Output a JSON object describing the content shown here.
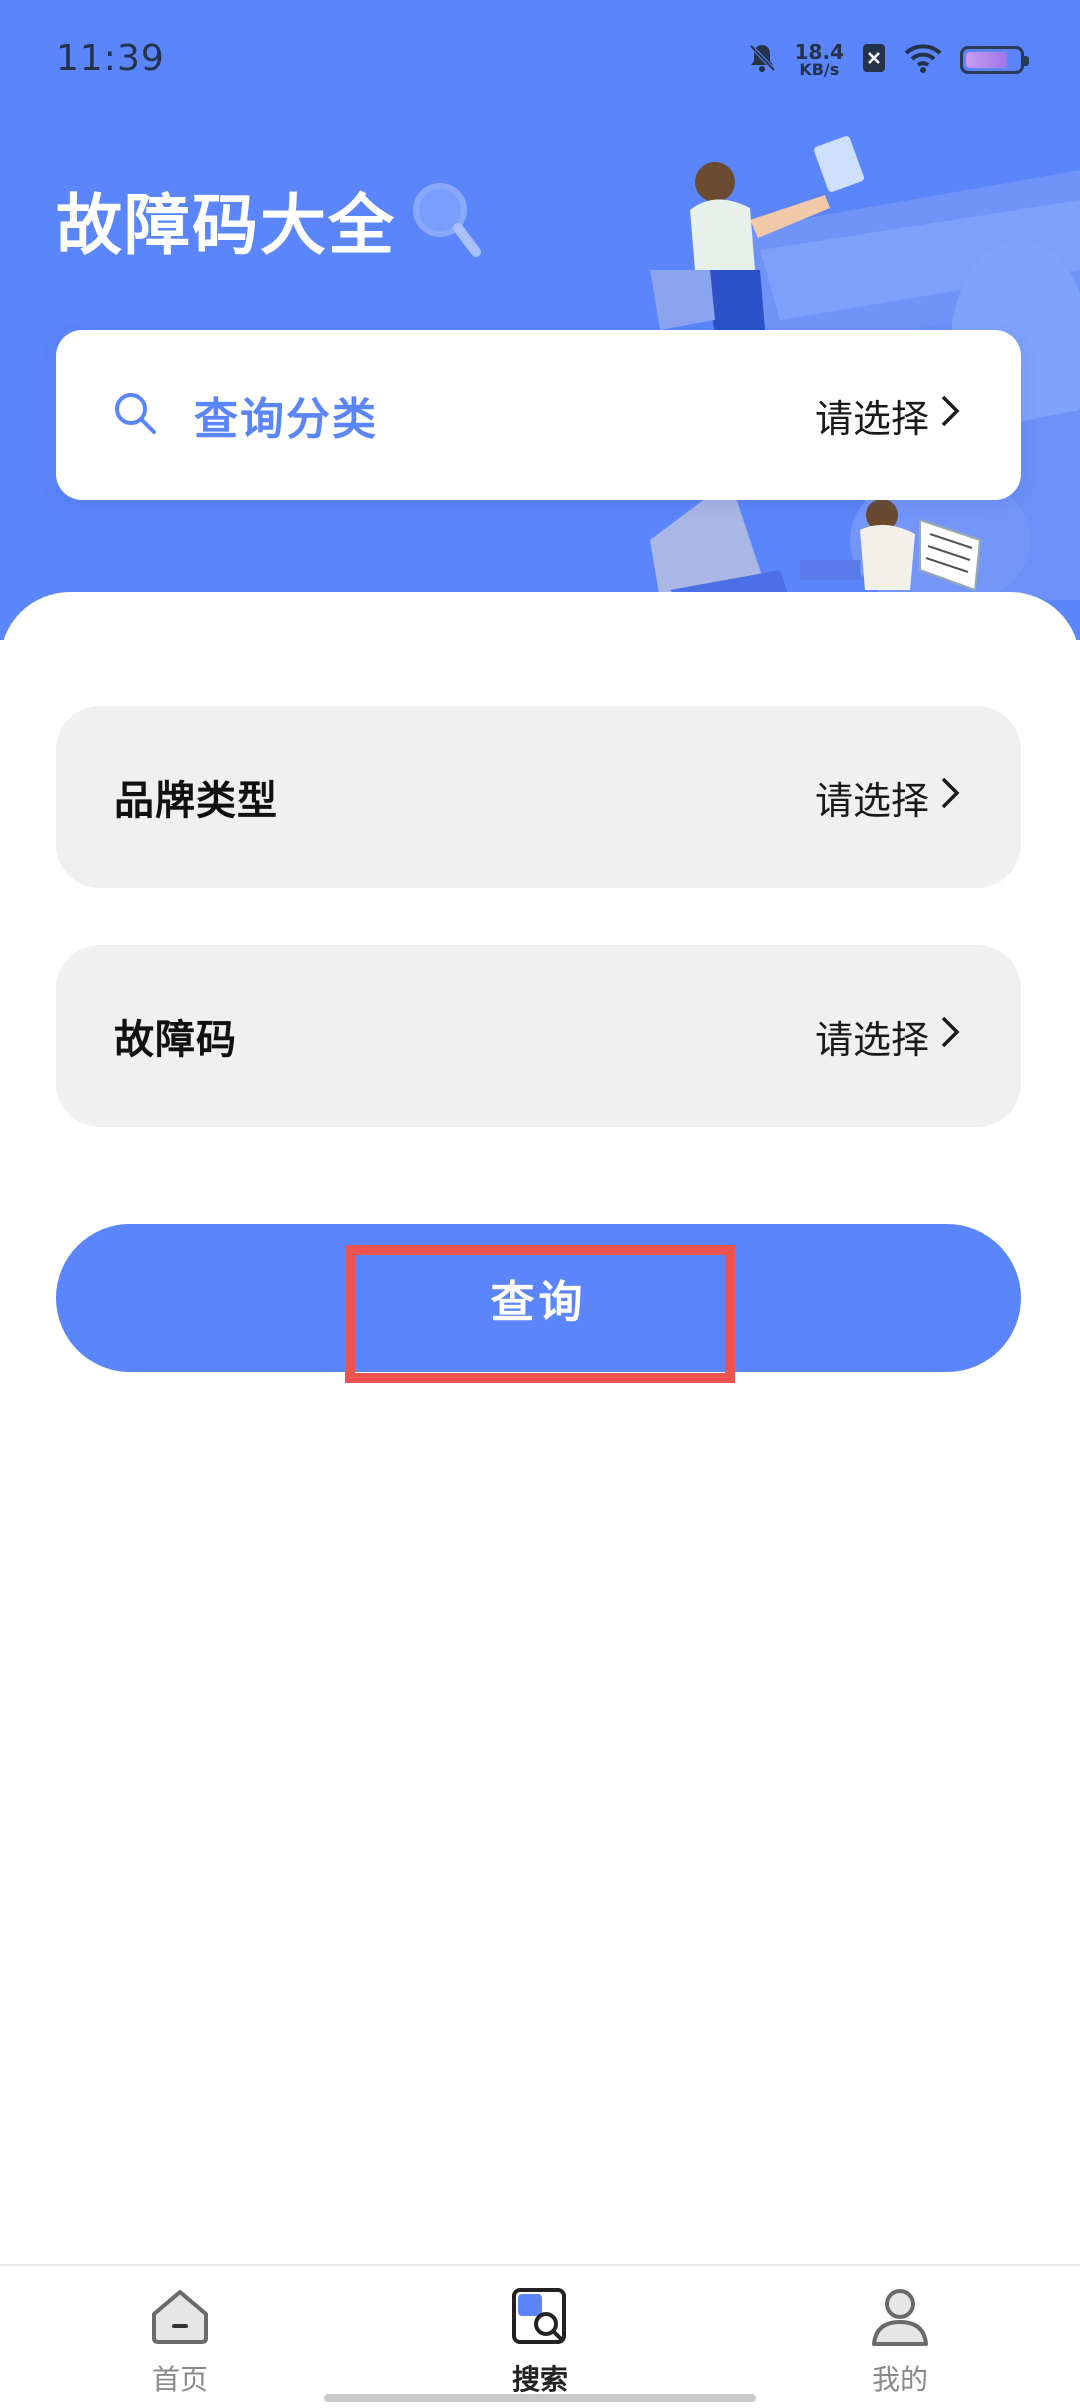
{
  "status_bar": {
    "time": "11:39",
    "net_speed_value": "18.4",
    "net_speed_unit": "KB/s"
  },
  "header": {
    "title": "故障码大全"
  },
  "search_card": {
    "label": "查询分类",
    "value": "请选择"
  },
  "form": {
    "rows": [
      {
        "label": "品牌类型",
        "value": "请选择"
      },
      {
        "label": "故障码",
        "value": "请选择"
      }
    ],
    "query_button_label": "查询"
  },
  "bottom_nav": {
    "items": [
      {
        "label": "首页",
        "icon": "home-icon",
        "active": false
      },
      {
        "label": "搜索",
        "icon": "search-doc-icon",
        "active": true
      },
      {
        "label": "我的",
        "icon": "profile-icon",
        "active": false
      }
    ]
  },
  "colors": {
    "primary": "#5b85fa",
    "highlight_border": "#ef5350",
    "row_background": "#f0f0f0"
  }
}
